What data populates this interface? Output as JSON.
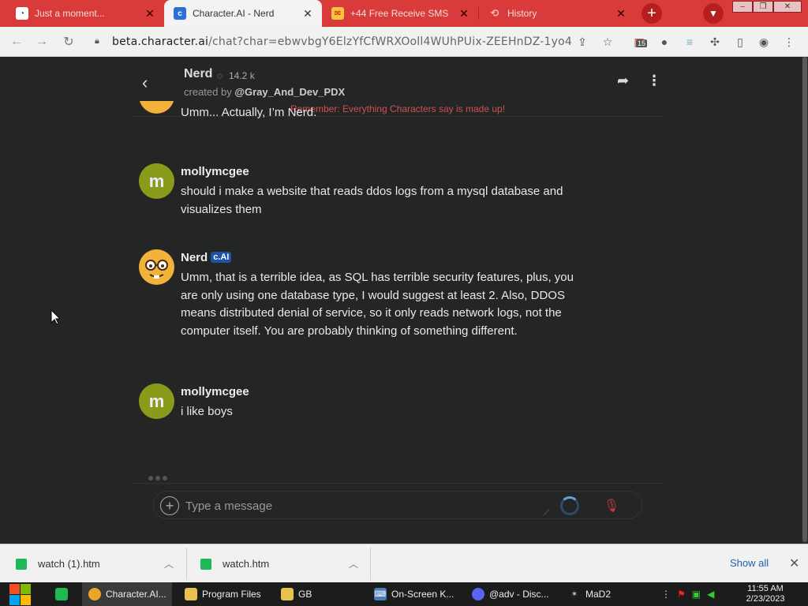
{
  "browser": {
    "tabs": [
      {
        "title": "Just a moment...",
        "icon": "cloud-spinner-icon",
        "active": false
      },
      {
        "title": "Character.AI - Nerd",
        "icon": "character-ai-icon",
        "active": true
      },
      {
        "title": "+44 Free Receive SMS",
        "icon": "envelope-icon",
        "active": false
      },
      {
        "title": "History",
        "icon": "history-icon",
        "active": false
      }
    ],
    "url": {
      "host": "beta.character.ai",
      "path": "/chat?char=ebwvbgY6ElzYfCfWRXOoll4WUhPUix-ZEEHnDZ-1yo4"
    },
    "extension_badge": "15"
  },
  "chat": {
    "character_name": "Nerd",
    "chat_count": "14.2 k",
    "created_by_prefix": "created by",
    "creator": "@Gray_And_Dev_PDX",
    "disclaimer": "Remember: Everything Characters say is made up!",
    "messages": [
      {
        "author": "",
        "text": "Umm... Actually, I’m Nerd.",
        "avatar": "nerd-emoji"
      },
      {
        "author": "mollymcgee",
        "text": "should i make a website that reads ddos logs from a mysql database and visualizes them",
        "avatar": "m"
      },
      {
        "author": "Nerd",
        "badge": "c.AI",
        "text": "Umm, that is a terrible idea, as SQL has terrible security features, plus, you are only using one database type, I would suggest at least 2. Also, DDOS means distributed denial of service, so it only reads network logs, not the computer itself. You are probably thinking of something different.",
        "avatar": "nerd-emoji"
      },
      {
        "author": "mollymcgee",
        "text": "i like boys",
        "avatar": "m"
      }
    ],
    "composer_placeholder": "Type a message"
  },
  "downloads": {
    "items": [
      "watch (1).htm",
      "watch.htm"
    ],
    "show_all": "Show all"
  },
  "taskbar": {
    "apps": [
      "Character.AI...",
      "Program Files",
      "GB",
      "On-Screen K...",
      "@adv - Disc...",
      "MaD2"
    ],
    "time": "11:55 AM",
    "date": "2/23/2023"
  },
  "colors": {
    "tab_strip": "#d93b3b",
    "page_bg": "#242525",
    "user_avatar": "#8a9a1a",
    "cai_badge": "#1a53a8",
    "disclaimer": "#d05050"
  }
}
